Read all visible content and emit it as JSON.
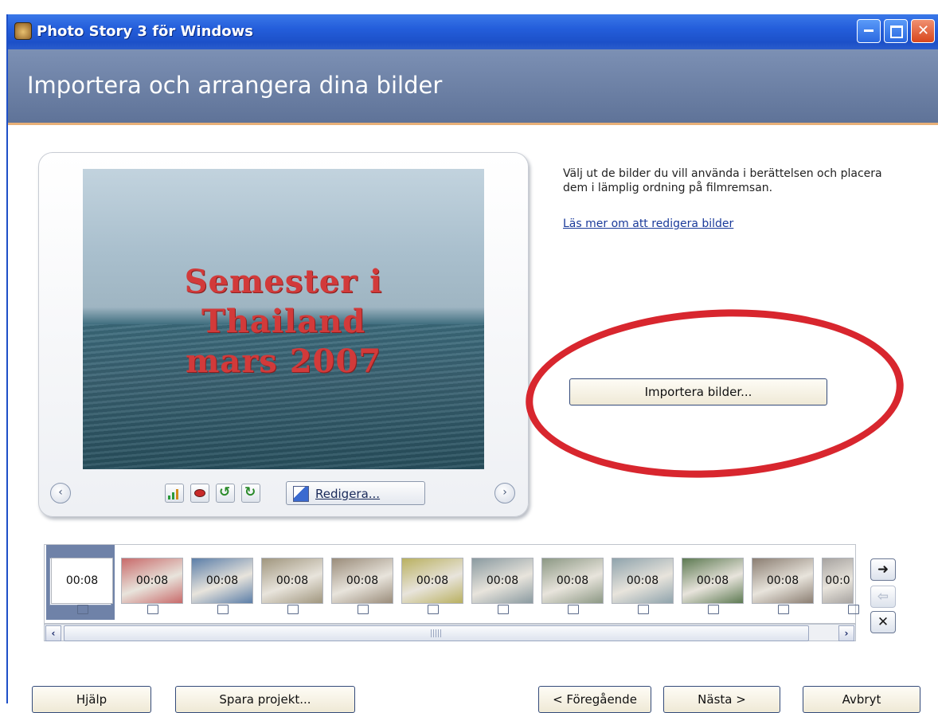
{
  "window": {
    "title": "Photo Story 3 för Windows",
    "minimize": "_",
    "maximize": "□",
    "close": "✕"
  },
  "header": {
    "title": "Importera och arrangera dina bilder"
  },
  "preview": {
    "photo_text": [
      "Semester i",
      "Thailand",
      "mars 2007"
    ],
    "prev_glyph": "‹",
    "next_glyph": "›",
    "tools": [
      "levels-icon",
      "red-eye-icon",
      "rotate-left-icon",
      "rotate-right-icon"
    ],
    "edit_label": "Redigera..."
  },
  "info": {
    "text": "Välj ut de bilder du vill använda i berättelsen och placera dem i lämplig ordning på filmremsan.",
    "link": "Läs mer om att redigera bilder"
  },
  "import_button": "Importera bilder...",
  "filmstrip": {
    "durations": [
      "00:08",
      "00:08",
      "00:08",
      "00:08",
      "00:08",
      "00:08",
      "00:08",
      "00:08",
      "00:08",
      "00:08",
      "00:08",
      "00:0"
    ],
    "thumb_colors": [
      "#ffffff",
      "#c86a6a",
      "#5b7ea8",
      "#a0967e",
      "#9a8c7a",
      "#b9b060",
      "#8a9aa0",
      "#8c9884",
      "#8fa3ac",
      "#5d7a52",
      "#8b7e72",
      "#a7a3a0"
    ]
  },
  "scroll": {
    "left": "‹",
    "right": "›"
  },
  "side_buttons": {
    "move_right": "➜",
    "move_left": "⇦",
    "delete": "✕"
  },
  "buttons": {
    "help": "Hjälp",
    "save": "Spara projekt...",
    "prev": "< Föregående",
    "next": "Nästa >",
    "cancel": "Avbryt"
  }
}
